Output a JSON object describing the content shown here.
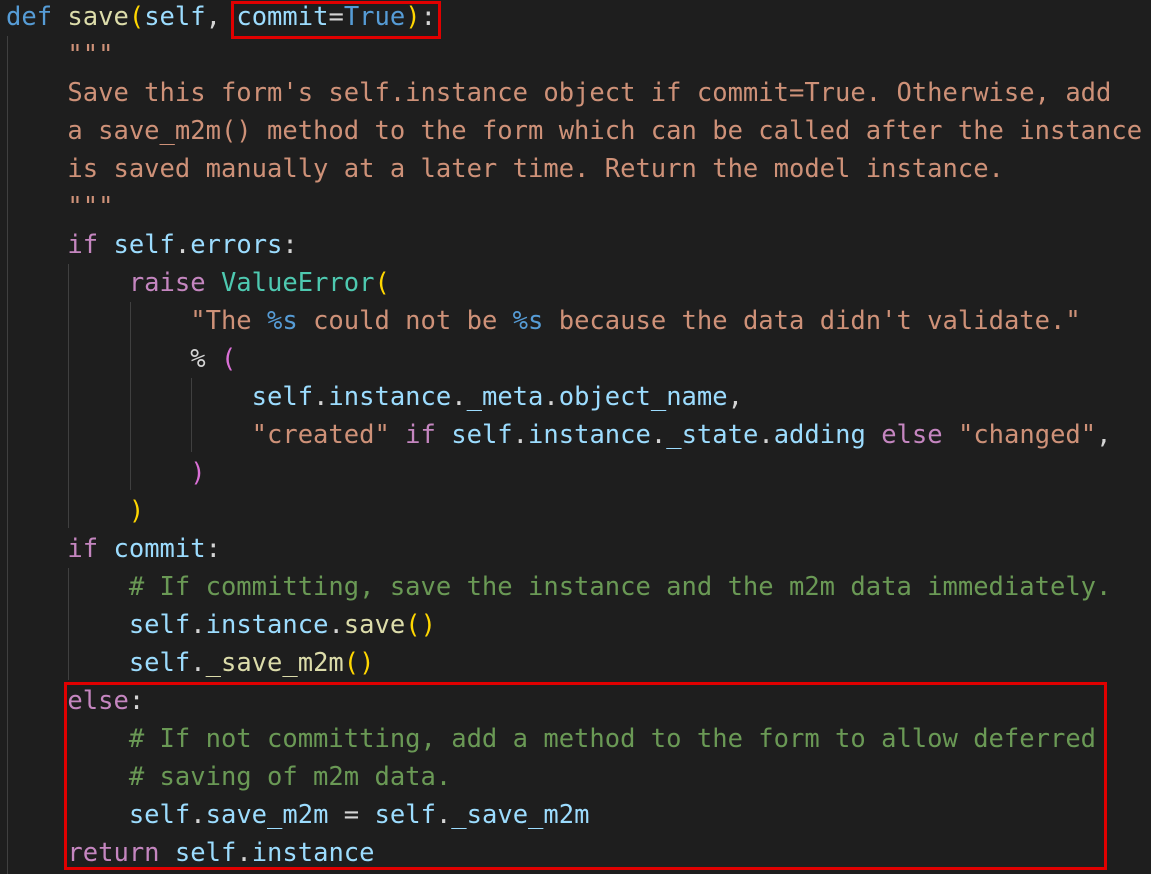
{
  "editor": {
    "language": "python",
    "colors": {
      "background": "#1e1e1e",
      "keyword": "#569cd6",
      "control": "#c586c0",
      "function": "#dcdcaa",
      "variable": "#9cdcfe",
      "class": "#4ec9b0",
      "string": "#ce9178",
      "comment": "#6a9955",
      "bracket_gold": "#ffd700",
      "bracket_pink": "#da70d6",
      "punctuation": "#d4d4d4",
      "indent_guide": "#404040",
      "highlight_box": "#e00000"
    },
    "lines": [
      [
        [
          "def",
          "keyword"
        ],
        [
          " ",
          "plain"
        ],
        [
          "save",
          "function"
        ],
        [
          "(",
          "bracket_gold"
        ],
        [
          "self",
          "variable"
        ],
        [
          ", ",
          "plain"
        ],
        [
          "commit",
          "variable"
        ],
        [
          "=",
          "plain"
        ],
        [
          "True",
          "keyword"
        ],
        [
          ")",
          "bracket_gold"
        ],
        [
          ":",
          "plain"
        ]
      ],
      [
        [
          "    ",
          "plain"
        ],
        [
          "\"\"\"",
          "string"
        ]
      ],
      [
        [
          "    ",
          "plain"
        ],
        [
          "Save this form's self.instance object if commit=True. Otherwise, add",
          "string"
        ]
      ],
      [
        [
          "    ",
          "plain"
        ],
        [
          "a save_m2m() method to the form which can be called after the instance",
          "string"
        ]
      ],
      [
        [
          "    ",
          "plain"
        ],
        [
          "is saved manually at a later time. Return the model instance.",
          "string"
        ]
      ],
      [
        [
          "    ",
          "plain"
        ],
        [
          "\"\"\"",
          "string"
        ]
      ],
      [
        [
          "    ",
          "plain"
        ],
        [
          "if",
          "control"
        ],
        [
          " ",
          "plain"
        ],
        [
          "self",
          "variable"
        ],
        [
          ".",
          "plain"
        ],
        [
          "errors",
          "variable"
        ],
        [
          ":",
          "plain"
        ]
      ],
      [
        [
          "        ",
          "plain"
        ],
        [
          "raise",
          "control"
        ],
        [
          " ",
          "plain"
        ],
        [
          "ValueError",
          "class"
        ],
        [
          "(",
          "bracket_gold"
        ]
      ],
      [
        [
          "            ",
          "plain"
        ],
        [
          "\"The ",
          "string"
        ],
        [
          "%s",
          "keyword"
        ],
        [
          " could not be ",
          "string"
        ],
        [
          "%s",
          "keyword"
        ],
        [
          " because the data didn't validate.\"",
          "string"
        ]
      ],
      [
        [
          "            ",
          "plain"
        ],
        [
          "%",
          "plain"
        ],
        [
          " ",
          "plain"
        ],
        [
          "(",
          "bracket_pink"
        ]
      ],
      [
        [
          "                ",
          "plain"
        ],
        [
          "self",
          "variable"
        ],
        [
          ".",
          "plain"
        ],
        [
          "instance",
          "variable"
        ],
        [
          ".",
          "plain"
        ],
        [
          "_meta",
          "variable"
        ],
        [
          ".",
          "plain"
        ],
        [
          "object_name",
          "variable"
        ],
        [
          ",",
          "plain"
        ]
      ],
      [
        [
          "                ",
          "plain"
        ],
        [
          "\"created\"",
          "string"
        ],
        [
          " ",
          "plain"
        ],
        [
          "if",
          "control"
        ],
        [
          " ",
          "plain"
        ],
        [
          "self",
          "variable"
        ],
        [
          ".",
          "plain"
        ],
        [
          "instance",
          "variable"
        ],
        [
          ".",
          "plain"
        ],
        [
          "_state",
          "variable"
        ],
        [
          ".",
          "plain"
        ],
        [
          "adding",
          "variable"
        ],
        [
          " ",
          "plain"
        ],
        [
          "else",
          "control"
        ],
        [
          " ",
          "plain"
        ],
        [
          "\"changed\"",
          "string"
        ],
        [
          ",",
          "plain"
        ]
      ],
      [
        [
          "            ",
          "plain"
        ],
        [
          ")",
          "bracket_pink"
        ]
      ],
      [
        [
          "        ",
          "plain"
        ],
        [
          ")",
          "bracket_gold"
        ]
      ],
      [
        [
          "    ",
          "plain"
        ],
        [
          "if",
          "control"
        ],
        [
          " ",
          "plain"
        ],
        [
          "commit",
          "variable"
        ],
        [
          ":",
          "plain"
        ]
      ],
      [
        [
          "        ",
          "plain"
        ],
        [
          "# If committing, save the instance and the m2m data immediately.",
          "comment"
        ]
      ],
      [
        [
          "        ",
          "plain"
        ],
        [
          "self",
          "variable"
        ],
        [
          ".",
          "plain"
        ],
        [
          "instance",
          "variable"
        ],
        [
          ".",
          "plain"
        ],
        [
          "save",
          "function"
        ],
        [
          "()",
          "bracket_gold"
        ]
      ],
      [
        [
          "        ",
          "plain"
        ],
        [
          "self",
          "variable"
        ],
        [
          ".",
          "plain"
        ],
        [
          "_save_m2m",
          "function"
        ],
        [
          "()",
          "bracket_gold"
        ]
      ],
      [
        [
          "    ",
          "plain"
        ],
        [
          "else",
          "control"
        ],
        [
          ":",
          "plain"
        ]
      ],
      [
        [
          "        ",
          "plain"
        ],
        [
          "# If not committing, add a method to the form to allow deferred",
          "comment"
        ]
      ],
      [
        [
          "        ",
          "plain"
        ],
        [
          "# saving of m2m data.",
          "comment"
        ]
      ],
      [
        [
          "        ",
          "plain"
        ],
        [
          "self",
          "variable"
        ],
        [
          ".",
          "plain"
        ],
        [
          "save_m2m",
          "variable"
        ],
        [
          " ",
          "plain"
        ],
        [
          "=",
          "plain"
        ],
        [
          " ",
          "plain"
        ],
        [
          "self",
          "variable"
        ],
        [
          ".",
          "plain"
        ],
        [
          "_save_m2m",
          "variable"
        ]
      ],
      [
        [
          "    ",
          "plain"
        ],
        [
          "return",
          "control"
        ],
        [
          " ",
          "plain"
        ],
        [
          "self",
          "variable"
        ],
        [
          ".",
          "plain"
        ],
        [
          "instance",
          "variable"
        ]
      ]
    ],
    "highlight_regions": [
      {
        "label": "commit-default-argument"
      },
      {
        "label": "else-branch-and-return"
      }
    ]
  }
}
